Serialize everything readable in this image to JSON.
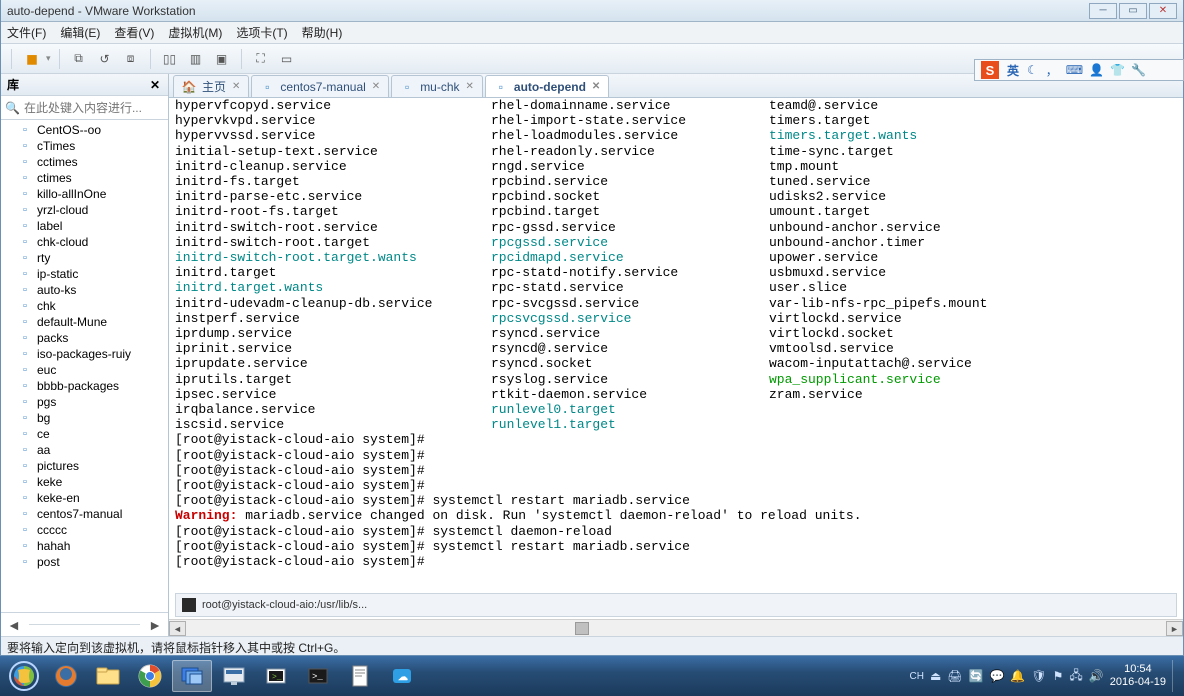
{
  "window": {
    "title": "auto-depend - VMware Workstation",
    "menus": [
      "文件(F)",
      "编辑(E)",
      "查看(V)",
      "虚拟机(M)",
      "选项卡(T)",
      "帮助(H)"
    ]
  },
  "sidebar": {
    "title": "库",
    "search_placeholder": "在此处键入内容进行...",
    "items": [
      "CentOS--oo",
      "cTimes",
      "cctimes",
      "ctimes",
      "killo-allInOne",
      "yrzl-cloud",
      "label",
      "chk-cloud",
      "rty",
      "ip-static",
      "auto-ks",
      "chk",
      "default-Mune",
      "packs",
      "iso-packages-ruiy",
      "euc",
      "bbbb-packages",
      "pgs",
      "bg",
      "ce",
      "aa",
      "pictures",
      "keke",
      "keke-en",
      "centos7-manual",
      "ccccc",
      "hahah",
      "post"
    ]
  },
  "tabs": {
    "home": "主页",
    "items": [
      "centos7-manual",
      "mu-chk",
      "auto-depend"
    ],
    "active": "auto-depend"
  },
  "terminal": {
    "col1": [
      {
        "t": "hypervfcopyd.service"
      },
      {
        "t": "hypervkvpd.service"
      },
      {
        "t": "hypervvssd.service"
      },
      {
        "t": "initial-setup-text.service"
      },
      {
        "t": "initrd-cleanup.service"
      },
      {
        "t": "initrd-fs.target"
      },
      {
        "t": "initrd-parse-etc.service"
      },
      {
        "t": "initrd-root-fs.target"
      },
      {
        "t": "initrd-switch-root.service"
      },
      {
        "t": "initrd-switch-root.target"
      },
      {
        "t": "initrd-switch-root.target.wants",
        "c": "link"
      },
      {
        "t": "initrd.target"
      },
      {
        "t": "initrd.target.wants",
        "c": "link"
      },
      {
        "t": "initrd-udevadm-cleanup-db.service"
      },
      {
        "t": "instperf.service"
      },
      {
        "t": "iprdump.service"
      },
      {
        "t": "iprinit.service"
      },
      {
        "t": "iprupdate.service"
      },
      {
        "t": "iprutils.target"
      },
      {
        "t": "ipsec.service"
      },
      {
        "t": "irqbalance.service"
      },
      {
        "t": "iscsid.service"
      }
    ],
    "col2": [
      {
        "t": "rhel-domainname.service"
      },
      {
        "t": "rhel-import-state.service"
      },
      {
        "t": "rhel-loadmodules.service"
      },
      {
        "t": "rhel-readonly.service"
      },
      {
        "t": "rngd.service"
      },
      {
        "t": "rpcbind.service"
      },
      {
        "t": "rpcbind.socket"
      },
      {
        "t": "rpcbind.target"
      },
      {
        "t": "rpc-gssd.service"
      },
      {
        "t": "rpcgssd.service",
        "c": "link"
      },
      {
        "t": "rpcidmapd.service",
        "c": "link"
      },
      {
        "t": "rpc-statd-notify.service"
      },
      {
        "t": "rpc-statd.service"
      },
      {
        "t": "rpc-svcgssd.service"
      },
      {
        "t": "rpcsvcgssd.service",
        "c": "link"
      },
      {
        "t": "rsyncd.service"
      },
      {
        "t": "rsyncd@.service"
      },
      {
        "t": "rsyncd.socket"
      },
      {
        "t": "rsyslog.service"
      },
      {
        "t": "rtkit-daemon.service"
      },
      {
        "t": "runlevel0.target",
        "c": "link"
      },
      {
        "t": "runlevel1.target",
        "c": "link"
      }
    ],
    "col3": [
      {
        "t": "teamd@.service"
      },
      {
        "t": "timers.target"
      },
      {
        "t": "timers.target.wants",
        "c": "link"
      },
      {
        "t": "time-sync.target"
      },
      {
        "t": "tmp.mount"
      },
      {
        "t": "tuned.service"
      },
      {
        "t": "udisks2.service"
      },
      {
        "t": "umount.target"
      },
      {
        "t": "unbound-anchor.service"
      },
      {
        "t": "unbound-anchor.timer"
      },
      {
        "t": "upower.service"
      },
      {
        "t": "usbmuxd.service"
      },
      {
        "t": "user.slice"
      },
      {
        "t": "var-lib-nfs-rpc_pipefs.mount"
      },
      {
        "t": "virtlockd.service"
      },
      {
        "t": "virtlockd.socket"
      },
      {
        "t": "vmtoolsd.service"
      },
      {
        "t": "wacom-inputattach@.service"
      },
      {
        "t": "wpa_supplicant.service",
        "c": "green"
      },
      {
        "t": "zram.service"
      }
    ],
    "prompt_lines": [
      "[root@yistack-cloud-aio system]#",
      "[root@yistack-cloud-aio system]#",
      "[root@yistack-cloud-aio system]#",
      "[root@yistack-cloud-aio system]#",
      "[root@yistack-cloud-aio system]# systemctl restart mariadb.service"
    ],
    "warning_label": "Warning:",
    "warning_text": " mariadb.service changed on disk. Run 'systemctl daemon-reload' to reload units.",
    "after_lines": [
      "[root@yistack-cloud-aio system]# systemctl daemon-reload",
      "[root@yistack-cloud-aio system]# systemctl restart mariadb.service",
      "[root@yistack-cloud-aio system]#"
    ],
    "pathbar": "root@yistack-cloud-aio:/usr/lib/s..."
  },
  "status_hint": "要将输入定向到该虚拟机，请将鼠标指针移入其中或按 Ctrl+G。",
  "ime": {
    "label": "英"
  },
  "clock": {
    "time": "10:54",
    "date": "2016-04-19"
  }
}
